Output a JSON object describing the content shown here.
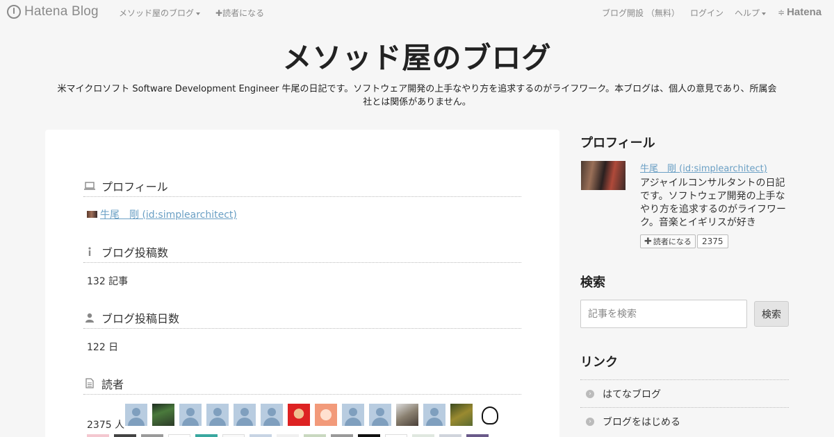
{
  "global_header": {
    "brand": "Hatena Blog",
    "blog_menu": "メソッド屋のブログ",
    "subscribe": "読者になる",
    "create_blog": "ブログ開設 （無料）",
    "login": "ログイン",
    "help": "ヘルプ",
    "hatena": "Hatena"
  },
  "blog": {
    "title": "メソッド屋のブログ",
    "description": "米マイクロソフト Software Development Engineer 牛尾の日記です。ソフトウェア開発の上手なやり方を追求するのがライフワーク。本ブログは、個人の意見であり、所属会社とは関係がありません。"
  },
  "main": {
    "profile_heading": "プロフィール",
    "profile_name": "牛尾　剛 (id:simplearchitect)",
    "posts_heading": "ブログ投稿数",
    "posts_value": "132 記事",
    "days_heading": "ブログ投稿日数",
    "days_value": "122 日",
    "readers_heading": "読者",
    "readers_value": "2375 人"
  },
  "sidebar": {
    "profile_heading": "プロフィール",
    "profile_name": "牛尾　剛 (id:simplearchitect)",
    "profile_desc": "アジャイルコンサルタントの日記です。ソフトウェア開発の上手なやり方を追求するのがライフワーク。音楽とイギリスが好き",
    "subscribe_label": "読者になる",
    "subscriber_count": "2375",
    "search_heading": "検索",
    "search_placeholder": "記事を検索",
    "search_button": "検索",
    "links_heading": "リンク",
    "links": [
      {
        "label": "はてなブログ"
      },
      {
        "label": "ブログをはじめる"
      }
    ]
  },
  "icons": {
    "profile": "laptop-icon",
    "posts": "info-icon",
    "days": "user-icon",
    "readers": "document-icon"
  },
  "colors": {
    "link": "#6a9fc4",
    "background": "#f6f6f6"
  }
}
